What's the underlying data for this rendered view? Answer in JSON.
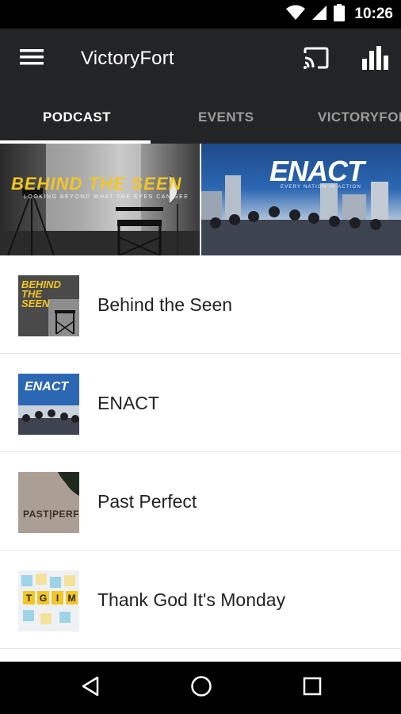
{
  "status_bar": {
    "time": "10:26",
    "icons": [
      "wifi-icon",
      "cell-signal-icon",
      "battery-icon"
    ]
  },
  "app_bar": {
    "title": "VictoryFort",
    "icons": [
      "menu-icon",
      "cast-icon",
      "stats-icon"
    ]
  },
  "tabs": [
    {
      "label": "PODCAST",
      "active": true
    },
    {
      "label": "EVENTS",
      "active": false
    },
    {
      "label": "VICTORYFOR",
      "active": false
    }
  ],
  "banners": {
    "left": {
      "title": "BEHIND THE SEEN",
      "subtitle": "LOOKING BEYOND WHAT THE EYES CAN SEE"
    },
    "right": {
      "title": "ENACT",
      "subtitle": "EVERY NATION IN ACTION"
    }
  },
  "podcasts": [
    {
      "title": "Behind the Seen"
    },
    {
      "title": "ENACT"
    },
    {
      "title": "Past Perfect"
    },
    {
      "title": "Thank God It's Monday"
    }
  ],
  "thumb_text": {
    "seen": [
      "BEHIND",
      "THE",
      "SEEN"
    ],
    "enact": "ENACT",
    "past": "PAST|PERFECT",
    "tgim": [
      "T",
      "G",
      "I",
      "M"
    ]
  },
  "colors": {
    "app_bar": "#232426",
    "status_bar": "#000000",
    "accent_yellow": "#f3c623",
    "enact_blue": "#2b67b3"
  }
}
